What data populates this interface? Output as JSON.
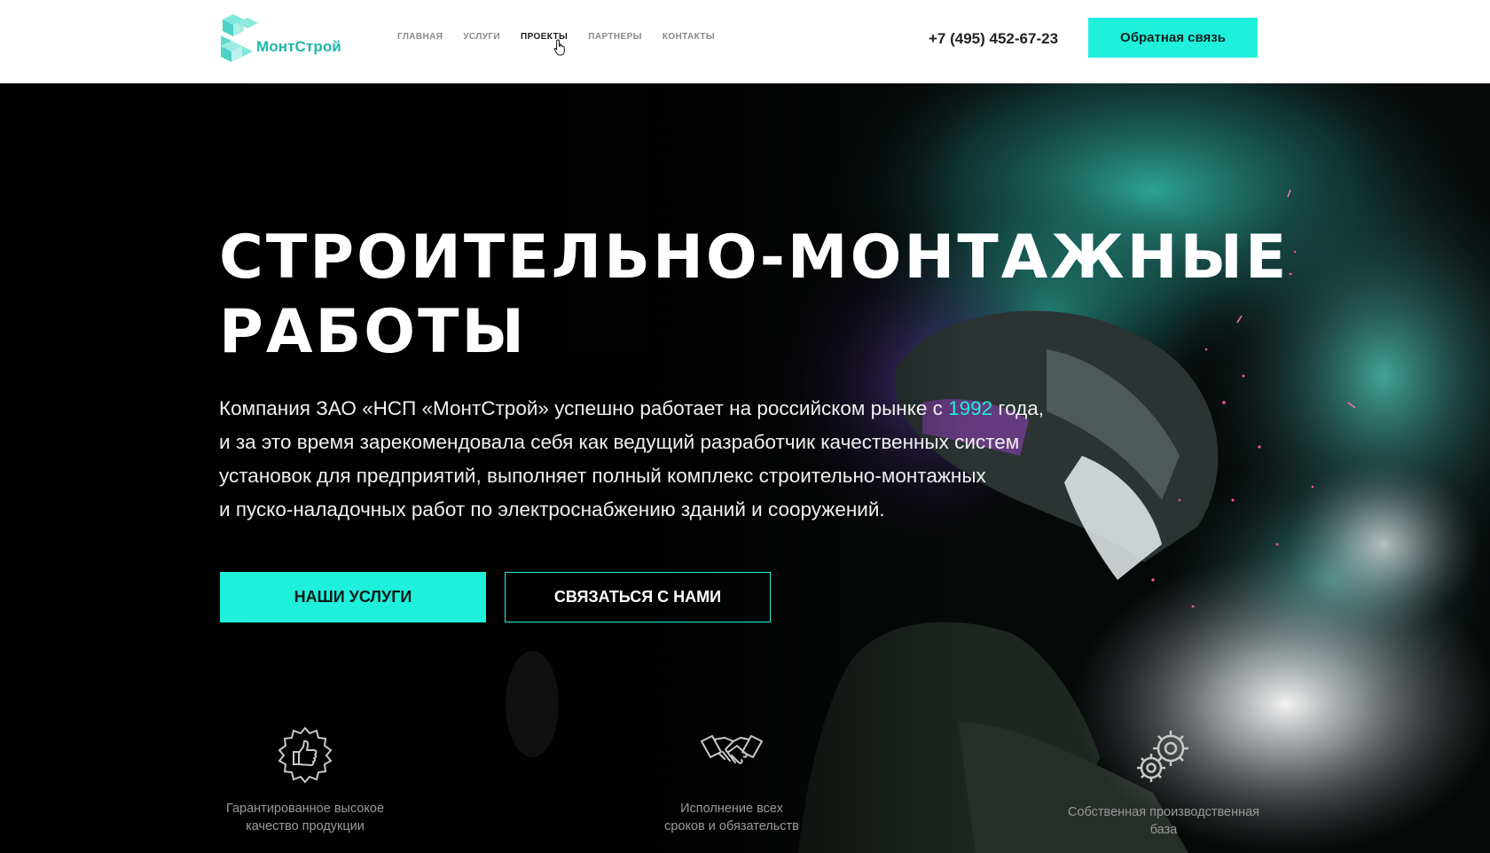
{
  "header": {
    "logo_text": "МонтСтрой",
    "nav": [
      {
        "label": "ГЛАВНАЯ",
        "active": false
      },
      {
        "label": "УСЛУГИ",
        "active": false
      },
      {
        "label": "ПРОЕКТЫ",
        "active": true
      },
      {
        "label": "ПАРТНЕРЫ",
        "active": false
      },
      {
        "label": "КОНТАКТЫ",
        "active": false
      }
    ],
    "phone": "+7 (495) 452-67-23",
    "callback_label": "Обратная связь"
  },
  "hero": {
    "title_line1": "СТРОИТЕЛЬНО-МОНТАЖНЫЕ",
    "title_line2": "РАБОТЫ",
    "desc_before_year": "Компания ЗАО «НСП «МонтСтрой» успешно работает на российском рынке с ",
    "year": "1992",
    "desc_after_year": " года,",
    "desc_line2": "и за это время зарекомендовала себя как ведущий разработчик качественных систем",
    "desc_line3": "установок для предприятий, выполняет полный комплекс строительно-монтажных",
    "desc_line4": "и пуско-наладочных работ по электроснабжению зданий и сооружений.",
    "btn_services": "НАШИ УСЛУГИ",
    "btn_contact": "СВЯЗАТЬСЯ С НАМИ"
  },
  "features": [
    {
      "icon": "thumbs-up-badge-icon",
      "line1": "Гарантированное высокое",
      "line2": "качество продукции"
    },
    {
      "icon": "handshake-icon",
      "line1": "Исполнение всех",
      "line2": "сроков и обязательств"
    },
    {
      "icon": "gears-icon",
      "line1": "Собственная производственная",
      "line2": "база"
    }
  ],
  "colors": {
    "accent": "#1ff0dc",
    "logo": "#1fb7a9",
    "header_bg": "#ffffff",
    "hero_bg": "#050606"
  }
}
